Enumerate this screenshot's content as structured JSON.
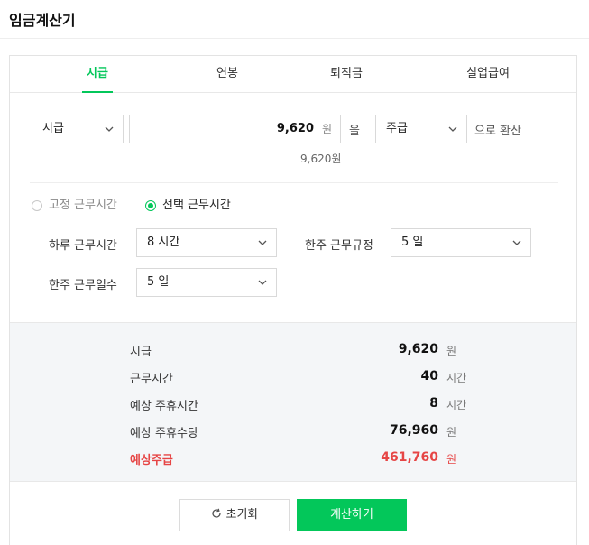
{
  "header": {
    "title": "임금계산기"
  },
  "tabs": [
    {
      "label": "시급",
      "active": true
    },
    {
      "label": "연봉",
      "active": false
    },
    {
      "label": "퇴직금",
      "active": false
    },
    {
      "label": "실업급여",
      "active": false
    }
  ],
  "converter": {
    "from_unit": "시급",
    "amount": "9,620",
    "amount_unit": "원",
    "particle": "을",
    "to_unit": "주급",
    "suffix": "으로 환산",
    "converted_text": "9,620원"
  },
  "work_mode": {
    "fixed_label": "고정 근무시간",
    "select_label": "선택 근무시간",
    "selected": "선택 근무시간"
  },
  "fields": {
    "daily_hours_label": "하루 근무시간",
    "daily_hours_value": "8 시간",
    "weekly_rule_label": "한주 근무규정",
    "weekly_rule_value": "5 일",
    "weekly_days_label": "한주 근무일수",
    "weekly_days_value": "5 일"
  },
  "summary": [
    {
      "key": "시급",
      "value": "9,620",
      "unit": "원"
    },
    {
      "key": "근무시간",
      "value": "40",
      "unit": "시간"
    },
    {
      "key": "예상 주휴시간",
      "value": "8",
      "unit": "시간"
    },
    {
      "key": "예상 주휴수당",
      "value": "76,960",
      "unit": "원"
    },
    {
      "key": "예상주급",
      "value": "461,760",
      "unit": "원",
      "highlight": true
    }
  ],
  "buttons": {
    "reset_label": "초기화",
    "calc_label": "계산하기"
  },
  "colors": {
    "accent": "#03c75a",
    "highlight": "#e64545"
  }
}
